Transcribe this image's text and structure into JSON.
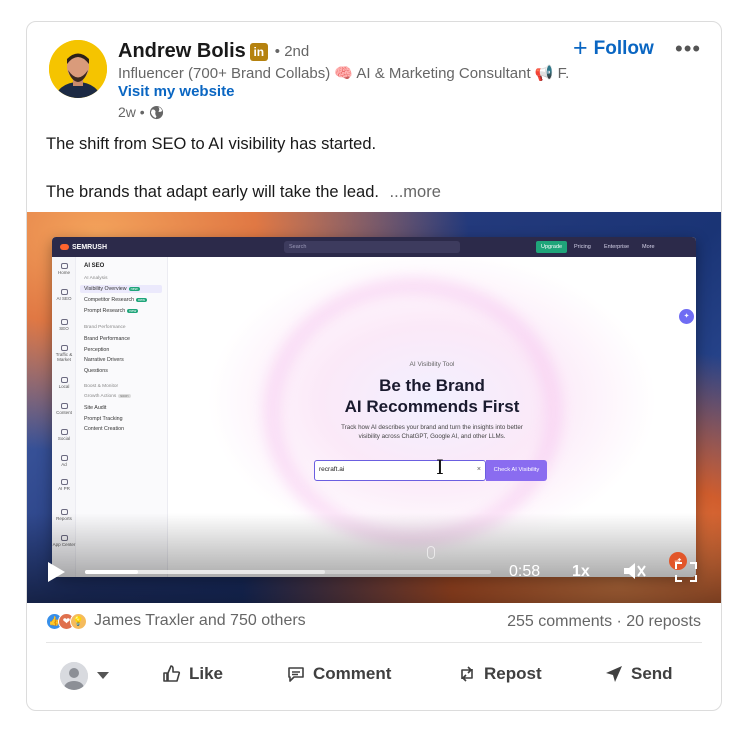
{
  "author": {
    "name": "Andrew Bolis",
    "badge": "in",
    "degree": "• 2nd",
    "headline": "Influencer (700+ Brand Collabs) 🧠 AI & Marketing Consultant 📢 F...",
    "website": "Visit my website",
    "age": "2w •"
  },
  "follow_label": "Follow",
  "post": {
    "line1": "The shift from SEO to AI visibility has started.",
    "line2": "The brands that adapt early will take the lead.",
    "more": "...more"
  },
  "video": {
    "app": {
      "brand": "SEMRUSH",
      "search_placeholder": "Search",
      "upgrade": "Upgrade",
      "pricing": "Pricing",
      "enterprise": "Enterprise",
      "more": "More",
      "rail": [
        "Home",
        "AI SEO",
        "SEO",
        "Traffic & Market",
        "Local",
        "Content",
        "Social",
        "Ad",
        "AI PR",
        "Reports",
        "App Center"
      ],
      "menu_title": "AI SEO",
      "menu": {
        "ai_analysis": "AI Analysis",
        "visibility_overview": "Visibility Overview",
        "competitor_research": "Competitor Research",
        "prompt_research": "Prompt Research",
        "new": "new",
        "brand_performance_hdr": "Brand Performance",
        "brand_performance": "Brand Performance",
        "perception": "Perception",
        "narrative_drivers": "Narrative Drivers",
        "questions": "Questions",
        "boost_monitor": "Boost & Monitor",
        "growth_actions": "Growth Actions",
        "soon": "soon",
        "site_audit": "Site Audit",
        "prompt_tracking": "Prompt Tracking",
        "content_creation": "Content Creation"
      },
      "tool_label": "AI Visibility Tool",
      "hero_line1": "Be the Brand",
      "hero_line2": "AI Recommends First",
      "hero_sub1": "Track how AI describes your brand and turn the insights into better",
      "hero_sub2": "visibility across ChatGPT, Google AI, and other LLMs.",
      "input_value": "recraft.ai",
      "cta": "Check AI Visibility"
    },
    "time": "0:58",
    "speed": "1x",
    "progress": 0.13,
    "buffered": 0.59
  },
  "social": {
    "reactors": "James Traxler and 750 others",
    "counts": "255 comments · 20 reposts"
  },
  "actions": {
    "like": "Like",
    "comment": "Comment",
    "repost": "Repost",
    "send": "Send"
  }
}
